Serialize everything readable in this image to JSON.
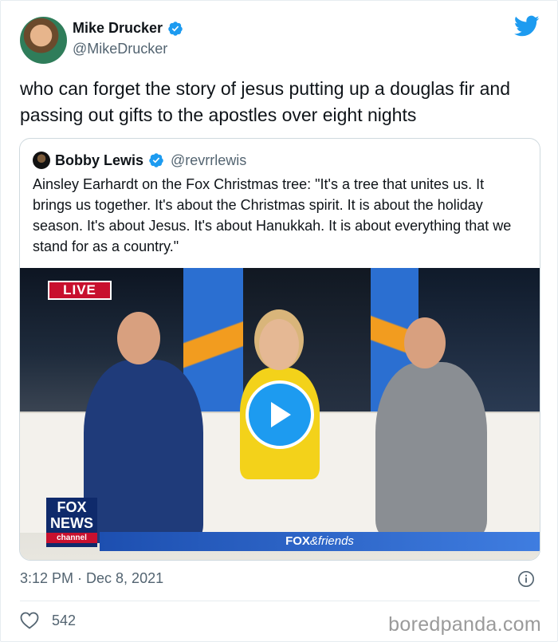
{
  "tweet": {
    "author_name": "Mike Drucker",
    "author_handle": "@MikeDrucker",
    "text": "who can forget the story of jesus putting up a douglas fir and passing out gifts to the apostles over eight nights",
    "timestamp": "3:12 PM · Dec 8, 2021",
    "like_count": "542"
  },
  "quoted_tweet": {
    "author_name": "Bobby Lewis",
    "author_handle": "@revrrlewis",
    "text": "Ainsley Earhardt on the Fox Christmas tree: \"It's a tree that unites us. It brings us together. It's about the Christmas spirit. It is about the holiday season. It's about Jesus. It's about Hanukkah. It is about everything that we stand for as a country.\""
  },
  "video": {
    "live_label": "LIVE",
    "logo_line1": "FOX",
    "logo_line2": "NEWS",
    "logo_line3": "channel",
    "show_name_bold": "FOX",
    "show_name_rest": "&friends"
  },
  "watermark": "boredpanda.com",
  "icons": {
    "verified": "verified-badge-icon",
    "twitter": "twitter-bird-icon",
    "play": "play-icon",
    "info": "info-icon",
    "like": "heart-icon"
  },
  "colors": {
    "twitter_blue": "#1d9bf0",
    "secondary_text": "#536471",
    "live_red": "#c8102e"
  }
}
